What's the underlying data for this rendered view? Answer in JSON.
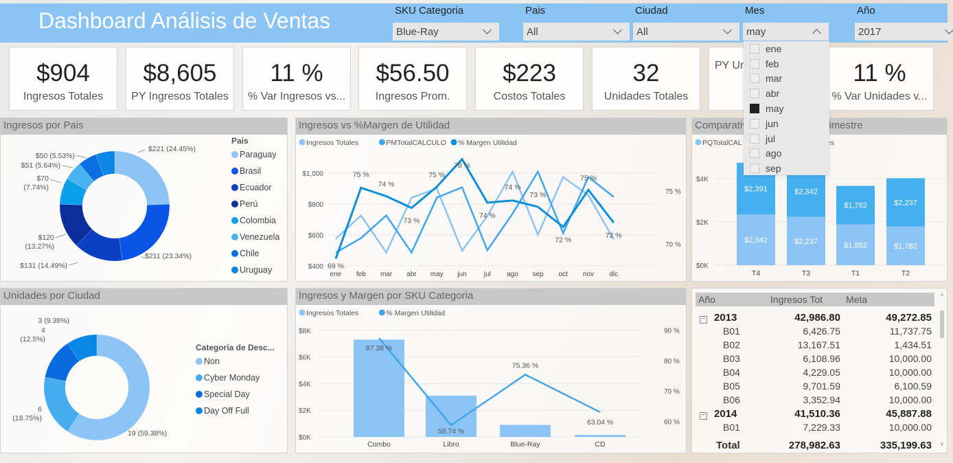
{
  "header": {
    "title": "Dashboard Análisis de Ventas"
  },
  "slicers": [
    {
      "label": "SKU Categoria",
      "value": "Blue-Ray"
    },
    {
      "label": "Pais",
      "value": "All"
    },
    {
      "label": "Ciudad",
      "value": "All"
    },
    {
      "label": "Mes",
      "value": "may",
      "open": true
    },
    {
      "label": "Año",
      "value": "2017"
    }
  ],
  "month_dropdown": {
    "items": [
      {
        "label": "ene",
        "checked": false
      },
      {
        "label": "feb",
        "checked": false
      },
      {
        "label": "mar",
        "checked": false
      },
      {
        "label": "abr",
        "checked": false
      },
      {
        "label": "may",
        "checked": true
      },
      {
        "label": "jun",
        "checked": false
      },
      {
        "label": "jul",
        "checked": false
      },
      {
        "label": "ago",
        "checked": false
      },
      {
        "label": "sep",
        "checked": false
      }
    ]
  },
  "kpis": [
    {
      "value": "$904",
      "label": "Ingresos Totales"
    },
    {
      "value": "$8,605",
      "label": "PY Ingresos Totales"
    },
    {
      "value": "11 %",
      "label": "% Var Ingresos vs..."
    },
    {
      "value": "$56.50",
      "label": "Ingresos Prom."
    },
    {
      "value": "$223",
      "label": "Costos Totales"
    },
    {
      "value": "32",
      "label": "Unidades Totales"
    },
    {
      "value": "",
      "label": "PY Un"
    },
    {
      "value": "11 %",
      "label": "% Var Unidades v..."
    }
  ],
  "chart_data": [
    {
      "id": "ingresos-por-pais",
      "type": "pie",
      "title": "Ingresos por Pais",
      "legend_title": "Pais",
      "categories": [
        "Paraguay",
        "Brasil",
        "Ecuador",
        "Perú",
        "Colombia",
        "Venezuela",
        "Chile",
        "Uruguay"
      ],
      "values": [
        221,
        211,
        131,
        120,
        70,
        51,
        50,
        50
      ],
      "data_labels": [
        "$221 (24.45%)",
        "$211 (23.34%)",
        "$131 (14.49%)",
        "$120 (13.27%)",
        "$70 (7.74%)",
        "$51 (5.64%)",
        "$50 (5.53%)",
        ""
      ],
      "colors": [
        "#8cc4f5",
        "#0a55e6",
        "#0a3fbf",
        "#0b2e9c",
        "#0aa0ea",
        "#48b3f0",
        "#0a6fe0",
        "#0a86e6"
      ]
    },
    {
      "id": "ingresos-vs-margen",
      "type": "line",
      "title": "Ingresos vs %Margen de Utilidad",
      "categories": [
        "ene",
        "feb",
        "mar",
        "abr",
        "may",
        "jun",
        "jul",
        "ago",
        "sep",
        "oct",
        "nov",
        "dic"
      ],
      "series": [
        {
          "name": "Ingresos Totales",
          "axis": "left",
          "color": "#8cc4f5",
          "values": [
            575,
            726,
            486,
            841,
            900,
            498,
            723,
            1009,
            601,
            975,
            856,
            572
          ]
        },
        {
          "name": "PMTotalCALCULO",
          "axis": "left",
          "color": "#3fa6ec",
          "values": [
            486,
            579,
            726,
            486,
            841,
            908,
            501,
            738,
            1009,
            612,
            975,
            846
          ]
        },
        {
          "name": "% Margen Utilidad",
          "axis": "right",
          "color": "#0b8fd9",
          "values": [
            68.6,
            75.3,
            74.5,
            73.4,
            75.4,
            78,
            73.9,
            74.1,
            73.5,
            71.6,
            75.1,
            72
          ],
          "data_labels": [
            "69 %",
            "75 %",
            "74 %",
            "73 %",
            "75 %",
            "78 %",
            "74 %",
            "74 %",
            "73 %",
            "72 %",
            "75 %",
            "72 %"
          ]
        }
      ],
      "ylim": [
        400,
        1000
      ],
      "yticks": [
        "$400",
        "$600",
        "$800",
        "$1,000"
      ],
      "y2ticks": [
        "70 %",
        "75 %"
      ],
      "grid": true,
      "legend": "top-left"
    },
    {
      "id": "comparativo-trimestre",
      "type": "bar",
      "stacked": true,
      "title_left": "Comparativ",
      "title_right": "Trimestre",
      "categories": [
        "T4",
        "T3",
        "T1",
        "T2"
      ],
      "series": [
        {
          "name": "PQTotalCAL",
          "color": "#8cc4f5",
          "values": [
            2342,
            2237,
            1882,
            1782
          ],
          "data_labels": [
            "$2,342",
            "$2,237",
            "$1,882",
            "$1,782"
          ]
        },
        {
          "name": "es",
          "color": "#45b0f0",
          "values": [
            2391,
            2342,
            1782,
            2237
          ],
          "data_labels": [
            "$2,391",
            "$2,342",
            "$1,782",
            "$2,237"
          ]
        }
      ],
      "ylim": [
        0,
        4000
      ],
      "yticks": [
        "$0K",
        "$2K",
        "$4K"
      ],
      "grid": true,
      "legend": "top-left"
    },
    {
      "id": "unidades-por-ciudad",
      "type": "pie",
      "title": "Unidades por Ciudad",
      "legend_title": "Categoria de Desc...",
      "categories": [
        "Non",
        "Cyber Monday",
        "Special Day",
        "Day Off Full"
      ],
      "values": [
        19,
        6,
        4,
        3
      ],
      "data_labels": [
        "19 (59.38%)",
        "6 (18.75%)",
        "4 (12.5%)",
        "3 (9.38%)"
      ],
      "colors": [
        "#8cc4f5",
        "#45acf0",
        "#0a6be0",
        "#0a86e6"
      ]
    },
    {
      "id": "ingresos-margen-sku",
      "type": "bar",
      "title": "Ingresos y Margen por SKU Categoria",
      "categories": [
        "Combo",
        "Libro",
        "Blue-Ray",
        "CD"
      ],
      "series": [
        {
          "name": "Ingresos Totales",
          "type": "bar",
          "color": "#8cc4f5",
          "values": [
            7300,
            3100,
            900,
            150
          ]
        },
        {
          "name": "% Margen Utilidad",
          "type": "line",
          "axis": "right",
          "color": "#3fa6ec",
          "values": [
            87.38,
            58.74,
            75.36,
            63.04
          ],
          "data_labels": [
            "87.38 %",
            "58.74 %",
            "75.36 %",
            "63.04 %"
          ]
        }
      ],
      "ylim": [
        0,
        8000
      ],
      "yticks": [
        "$0K",
        "$2K",
        "$4K",
        "$6K",
        "$8K"
      ],
      "y2lim": [
        55,
        90
      ],
      "y2ticks": [
        "60 %",
        "70 %",
        "80 %",
        "90 %"
      ],
      "grid": true,
      "legend": "top-left"
    }
  ],
  "table": {
    "columns": [
      "Año",
      "Ingresos Tot",
      "Meta"
    ],
    "rows": [
      {
        "label": "2013",
        "ingresos": "42,986.80",
        "meta": "49,272.85",
        "group": true
      },
      {
        "label": "B01",
        "ingresos": "6,426.75",
        "meta": "11,737.75"
      },
      {
        "label": "B02",
        "ingresos": "13,167.51",
        "meta": "1,434.51"
      },
      {
        "label": "B03",
        "ingresos": "6,108.96",
        "meta": "10,000.00"
      },
      {
        "label": "B04",
        "ingresos": "4,229.05",
        "meta": "10,000.00"
      },
      {
        "label": "B05",
        "ingresos": "9,701.59",
        "meta": "6,100.59"
      },
      {
        "label": "B06",
        "ingresos": "3,352.94",
        "meta": "10,000.00"
      },
      {
        "label": "2014",
        "ingresos": "41,510.36",
        "meta": "45,887.88",
        "group": true
      },
      {
        "label": "B01",
        "ingresos": "7,229.33",
        "meta": "10,000.00"
      }
    ],
    "total": {
      "label": "Total",
      "ingresos": "278,982.63",
      "meta": "335,199.63"
    }
  }
}
